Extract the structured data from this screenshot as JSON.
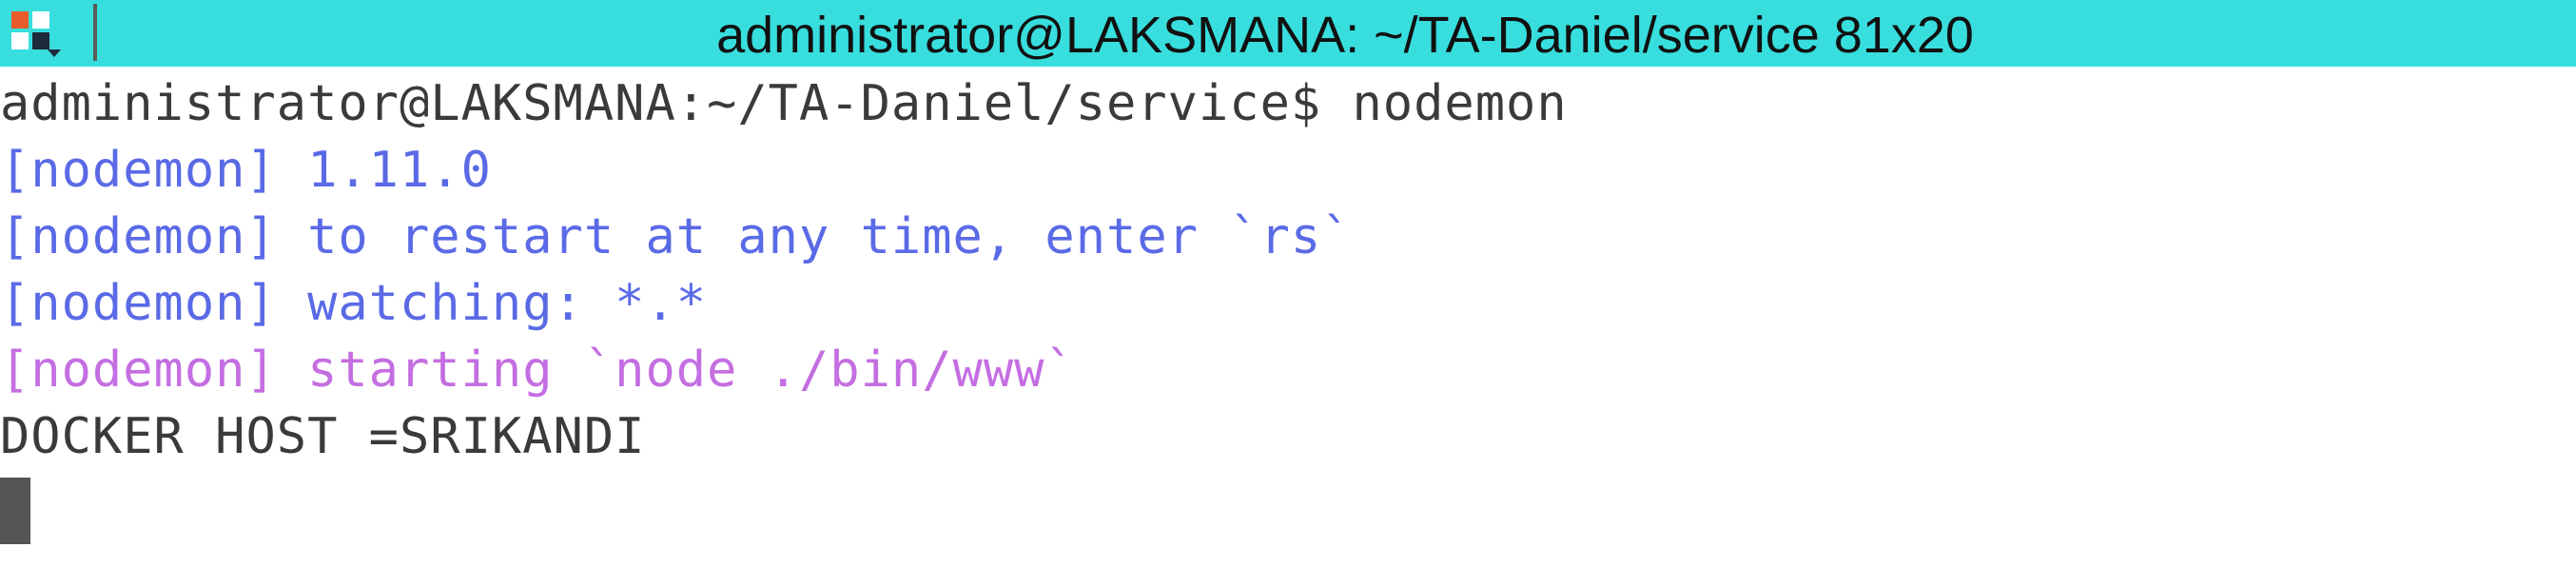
{
  "window": {
    "title": "administrator@LAKSMANA: ~/TA-Daniel/service 81x20",
    "title_bar_color": "#38dede"
  },
  "terminal": {
    "lines": [
      {
        "text": "administrator@LAKSMANA:~/TA-Daniel/service$ nodemon",
        "color": "#3a3a3a"
      },
      {
        "text": "[nodemon] 1.11.0",
        "color": "#5a6ae6"
      },
      {
        "text": "[nodemon] to restart at any time, enter `rs`",
        "color": "#5a6ae6"
      },
      {
        "text": "[nodemon] watching: *.*",
        "color": "#5a6ae6"
      },
      {
        "text": "[nodemon] starting `node ./bin/www`",
        "color": "#c46ee2"
      },
      {
        "text": "DOCKER HOST =SRIKANDI",
        "color": "#3a3a3a"
      }
    ],
    "cursor": "block-cursor"
  }
}
